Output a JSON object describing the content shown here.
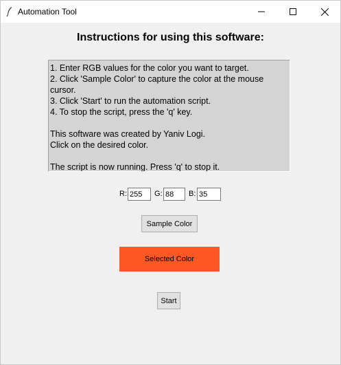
{
  "window": {
    "title": "Automation Tool"
  },
  "heading": "Instructions for using this software:",
  "instructions": [
    "1. Enter RGB values for the color you want to target.",
    "2. Click 'Sample Color' to capture the color at the mouse",
    "cursor.",
    "3. Click 'Start' to run the automation script.",
    "4. To stop the script, press the 'q' key.",
    "",
    "This software was created by Yaniv Logi.",
    "Click on the desired color.",
    "",
    "The script is now running. Press 'q' to stop it."
  ],
  "rgb": {
    "r_label": "R:",
    "r_value": "255",
    "g_label": "G:",
    "g_value": "88",
    "b_label": "B:",
    "b_value": "35"
  },
  "buttons": {
    "sample_label": "Sample Color",
    "start_label": "Start"
  },
  "swatch": {
    "label": "Selected Color",
    "color": "#ff5823"
  }
}
